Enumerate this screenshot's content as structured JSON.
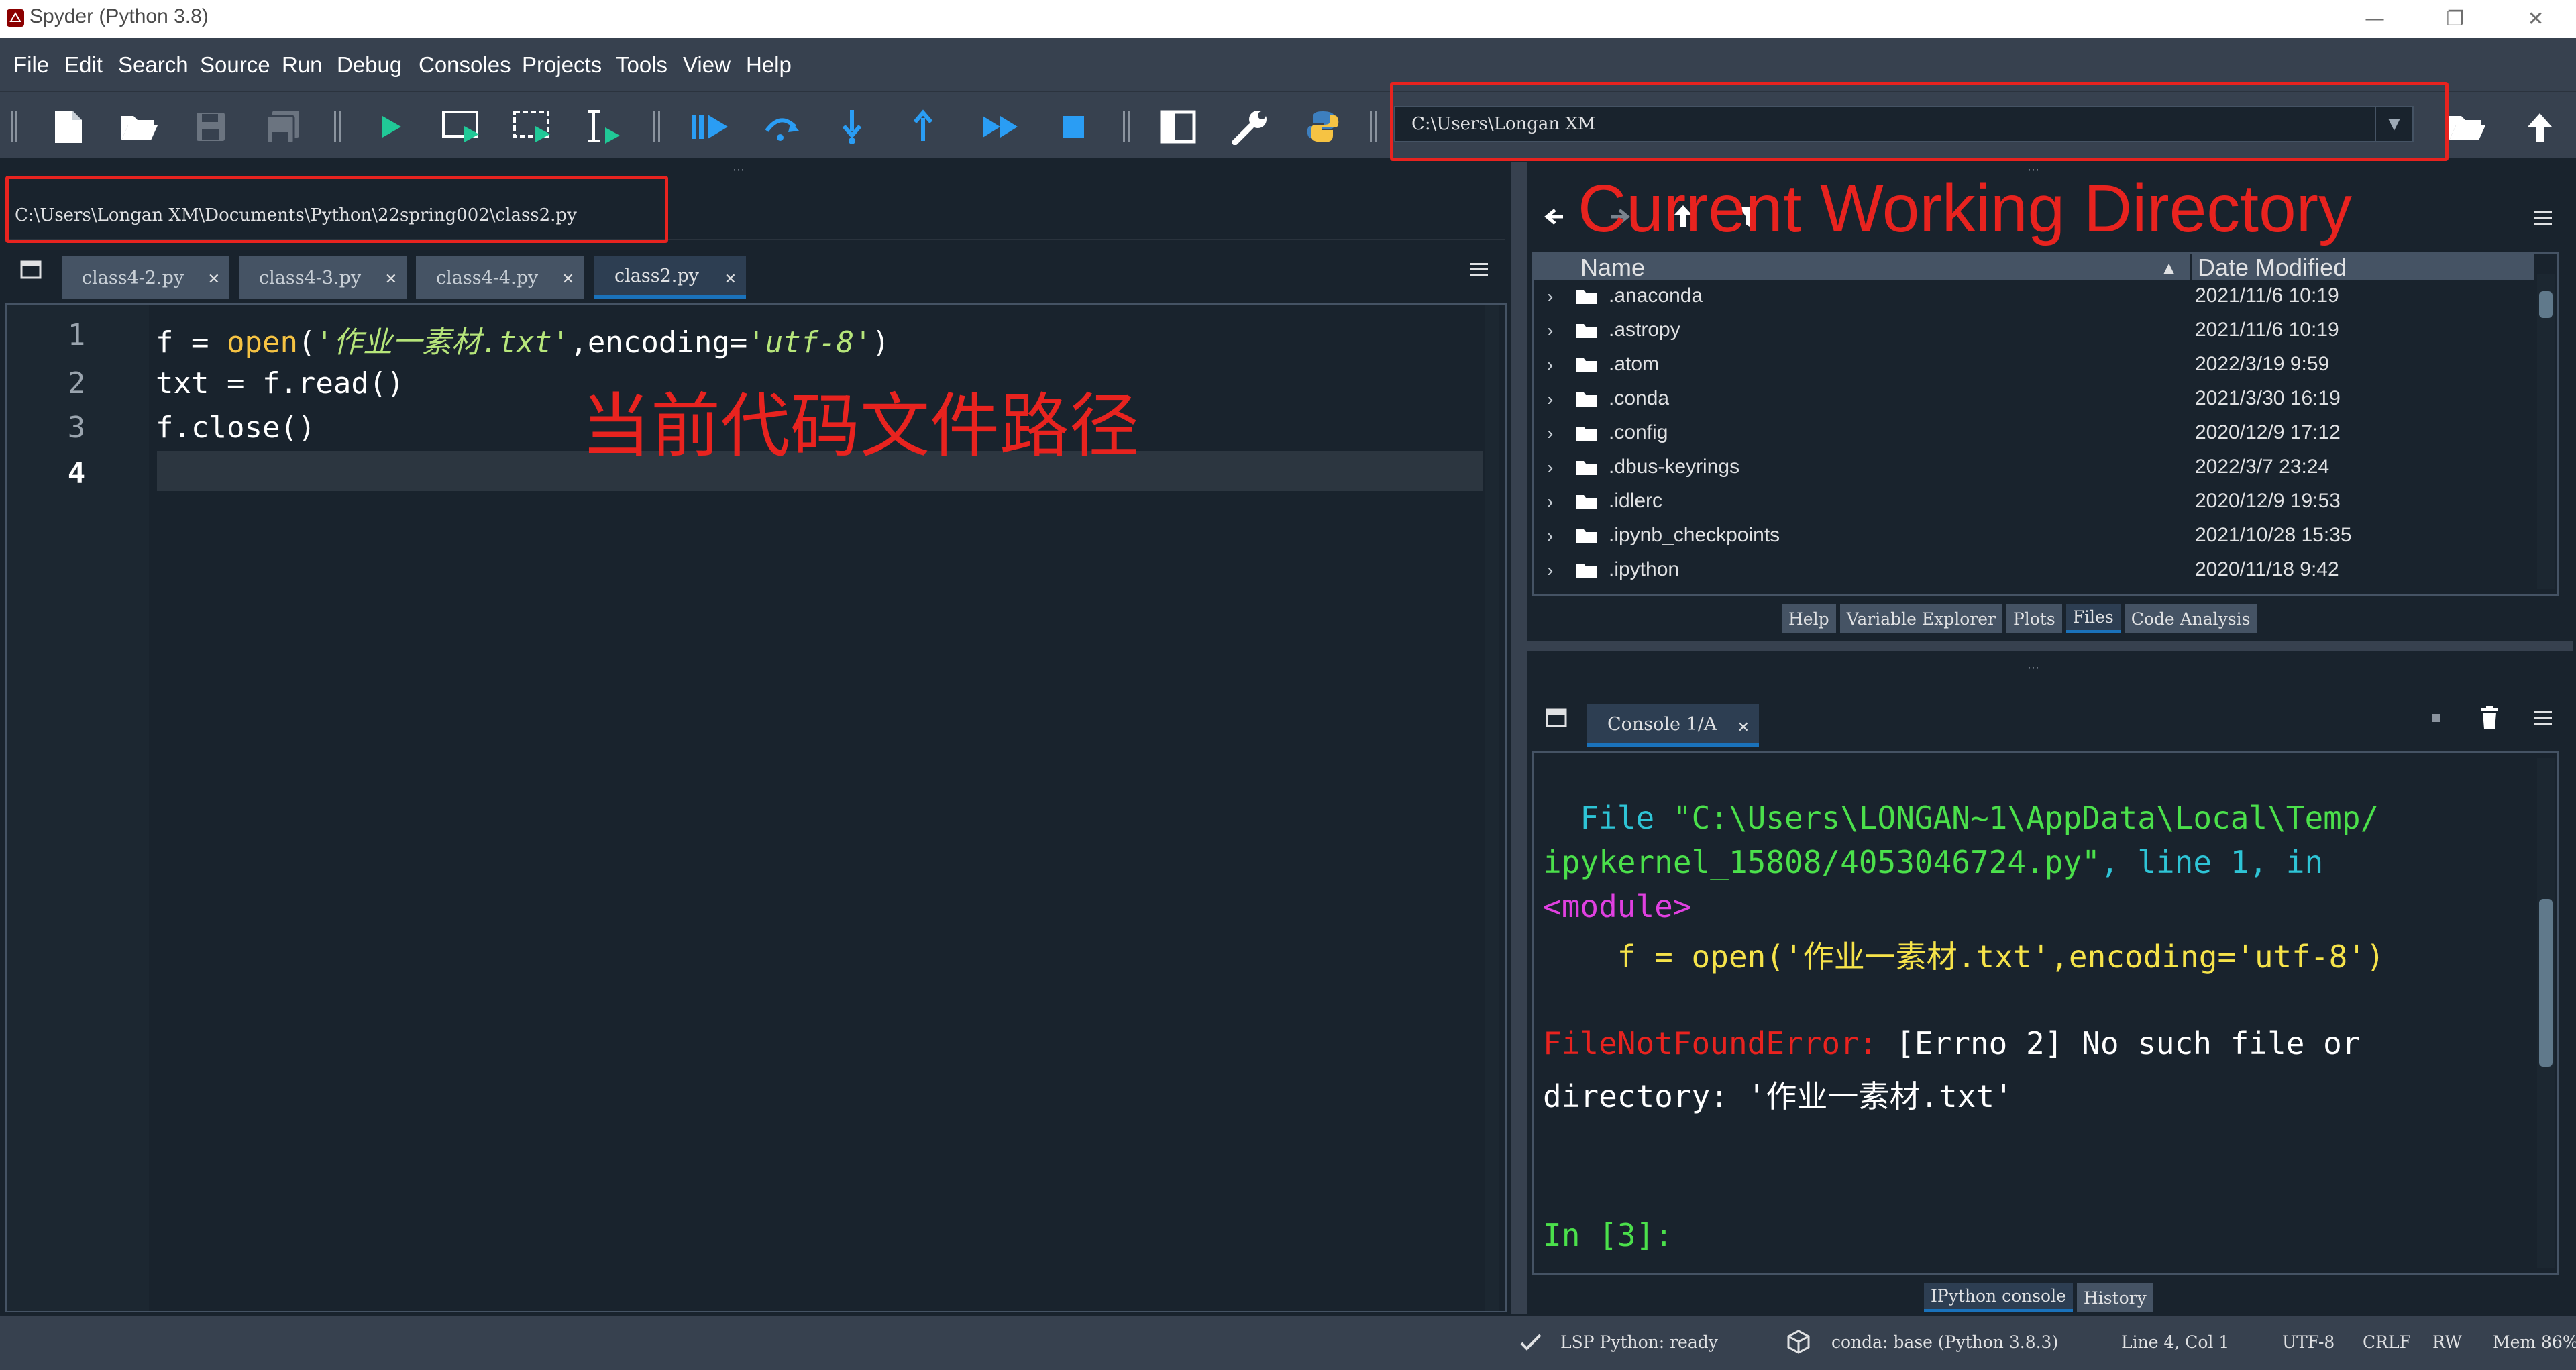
{
  "window": {
    "title": "Spyder (Python 3.8)",
    "minimize_glyph": "—",
    "restore_glyph": "❐",
    "close_glyph": "✕"
  },
  "menu": [
    "File",
    "Edit",
    "Search",
    "Source",
    "Run",
    "Debug",
    "Consoles",
    "Projects",
    "Tools",
    "View",
    "Help"
  ],
  "toolbar": {
    "icons": [
      "new-file-icon",
      "open-file-icon",
      "save-icon",
      "save-all-icon",
      "run-icon",
      "run-cell-icon",
      "run-cell-advance-icon",
      "run-selection-icon",
      "debug-icon",
      "step-over-icon",
      "step-into-icon",
      "step-out-icon",
      "continue-icon",
      "stop-icon",
      "maximize-pane-icon",
      "preferences-wrench-icon",
      "python-path-icon",
      "browse-folder-icon",
      "parent-directory-icon"
    ],
    "working_directory": "C:\\Users\\Longan XM"
  },
  "editor": {
    "file_path": "C:\\Users\\Longan XM\\Documents\\Python\\22spring002\\class2.py",
    "tabs": [
      {
        "label": "class4-2.py",
        "active": false
      },
      {
        "label": "class4-3.py",
        "active": false
      },
      {
        "label": "class4-4.py",
        "active": false
      },
      {
        "label": "class2.py",
        "active": true
      }
    ],
    "line_numbers": [
      "1",
      "2",
      "3",
      "4"
    ],
    "code": {
      "l1_a": "f = ",
      "l1_func": "open",
      "l1_b": "(",
      "l1_str1": "'作业一素材.txt'",
      "l1_c": ",encoding=",
      "l1_str2": "'utf-8'",
      "l1_d": ")",
      "l2": "txt = f.read()",
      "l3": "f.close()"
    }
  },
  "annotations": {
    "cwd_label": "Current Working Directory",
    "file_path_label": "当前代码文件路径",
    "color": "#e8231f"
  },
  "files": {
    "columns": [
      "Name",
      "Date Modified"
    ],
    "rows": [
      {
        "name": ".anaconda",
        "date": "2021/11/6 10:19"
      },
      {
        "name": ".astropy",
        "date": "2021/11/6 10:19"
      },
      {
        "name": ".atom",
        "date": "2022/3/19 9:59"
      },
      {
        "name": ".conda",
        "date": "2021/3/30 16:19"
      },
      {
        "name": ".config",
        "date": "2020/12/9 17:12"
      },
      {
        "name": ".dbus-keyrings",
        "date": "2022/3/7 23:24"
      },
      {
        "name": ".idlerc",
        "date": "2020/12/9 19:53"
      },
      {
        "name": ".ipynb_checkpoints",
        "date": "2021/10/28 15:35"
      },
      {
        "name": ".ipython",
        "date": "2020/11/18 9:42"
      }
    ],
    "pane_tabs": [
      {
        "label": "Help",
        "active": false
      },
      {
        "label": "Variable Explorer",
        "active": false
      },
      {
        "label": "Plots",
        "active": false
      },
      {
        "label": "Files",
        "active": true
      },
      {
        "label": "Code Analysis",
        "active": false
      }
    ]
  },
  "console": {
    "tab_label": "Console 1/A",
    "lines": {
      "file_prefix": "  File ",
      "file_path_1": "\"C:\\Users\\LONGAN~1\\AppData\\Local\\Temp/",
      "file_path_2": "ipykernel_15808/4053046724.py\"",
      "line_info": ", line 1, in",
      "module": "<module>",
      "code": "    f = open('作业一素材.txt',encoding='utf-8')",
      "err_name": "FileNotFoundError:",
      "err_msg_1": " [Errno 2] No such file or",
      "err_msg_2": "directory: '作业一素材.txt'",
      "prompt": "In [3]:"
    },
    "pane_tabs": [
      {
        "label": "IPython console",
        "active": true
      },
      {
        "label": "History",
        "active": false
      }
    ]
  },
  "status": {
    "lsp": "LSP Python: ready",
    "conda": "conda: base (Python 3.8.3)",
    "cursor": "Line 4, Col 1",
    "encoding": "UTF-8",
    "eol": "CRLF",
    "rw": "RW",
    "mem": "Mem 86%"
  }
}
